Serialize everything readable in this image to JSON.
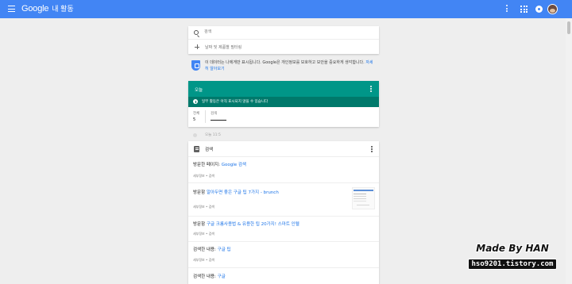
{
  "header": {
    "logo_text": "Google",
    "title": "내 활동",
    "background_color": "#4285f4",
    "icons": [
      "menu-icon",
      "more-vert-icon",
      "apps-icon",
      "notifications-icon",
      "avatar"
    ]
  },
  "search": {
    "placeholder": "검색",
    "filter_label": "날짜 및 제품별 필터링"
  },
  "notice": {
    "text": "이 데이터는 나에게만 표시됩니다. Google은 개인정보를 보호하고 보안을 중요하게 생각합니다. ",
    "link": "자세히 알아보기"
  },
  "summary_card": {
    "title": "오늘",
    "subtitle": "일부 활동은 아직 표시되지 않을 수 있습니다",
    "accent_color": "#009688",
    "stats": [
      {
        "label": "전체",
        "value": "5"
      },
      {
        "label": "검색",
        "value": ""
      }
    ]
  },
  "date_header": "오늘 11:5",
  "activity": {
    "category": "검색",
    "entries": [
      {
        "prefix": "방문한 페이지:",
        "link": "Google 검색",
        "meta": "세부정보 • 검색"
      },
      {
        "prefix": "방문함",
        "link": "알아두면 좋은 구글 팁 7가지 - brunch",
        "meta": "세부정보 • 검색"
      },
      {
        "prefix": "방문함",
        "link": "구글 크롬사용법 & 유용한 팁 20가지! 스마트 인텔",
        "meta": "세부정보 • 검색"
      },
      {
        "prefix": "검색한 내용:",
        "link": "구글 팁",
        "meta": "세부정보 • 검색"
      },
      {
        "prefix": "검색한 내용:",
        "link": "구글",
        "meta": ""
      }
    ]
  },
  "watermark": {
    "title": "Made By HAN",
    "url": "hso9201.tistory.com"
  }
}
